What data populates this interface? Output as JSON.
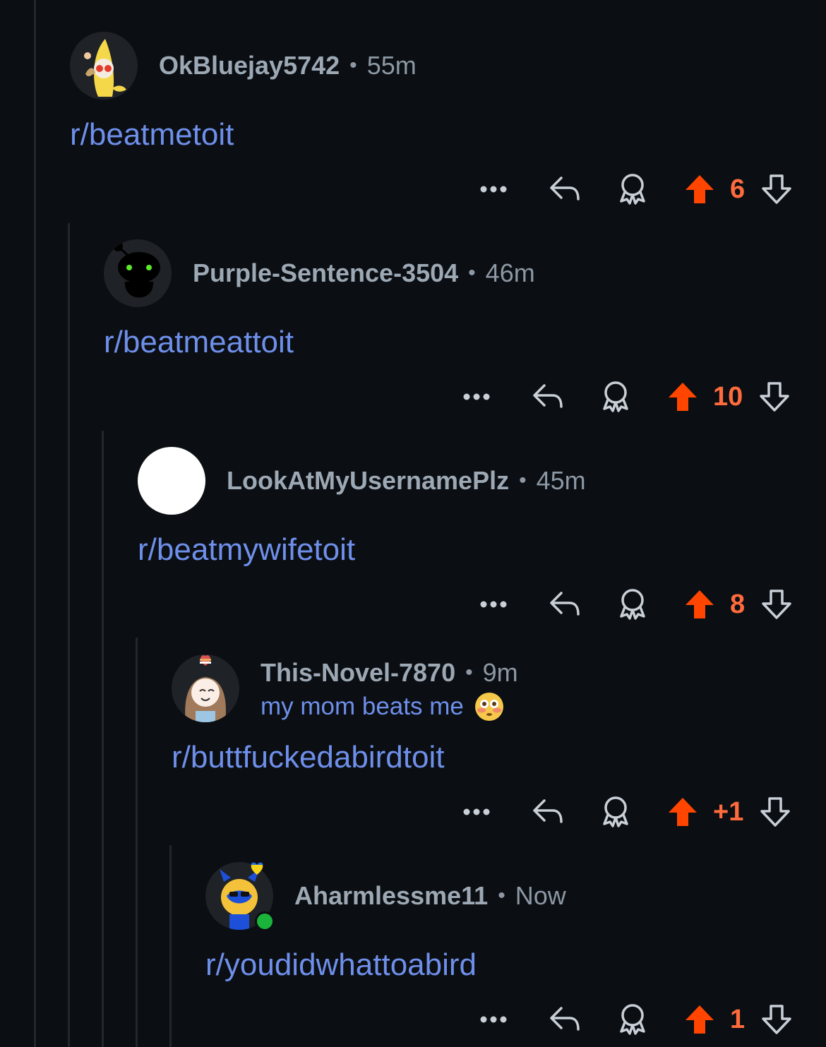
{
  "comments": [
    {
      "username": "OkBluejay5742",
      "time": "55m",
      "body": "r/beatmetoit",
      "score": "6",
      "avatar_icon": "banana-avatar-icon"
    },
    {
      "username": "Purple-Sentence-3504",
      "time": "46m",
      "body": "r/beatmeattoit",
      "score": "10",
      "avatar_icon": "snoo-silhouette-avatar-icon"
    },
    {
      "username": "LookAtMyUsernamePlz",
      "time": "45m",
      "body": "r/beatmywifetoit",
      "score": "8",
      "avatar_icon": "blank-avatar-icon"
    },
    {
      "username": "This-Novel-7870",
      "time": "9m",
      "flair": "my mom beats me",
      "flair_emoji": "flushed-face-emoji",
      "body": "r/buttfuckedabirdtoit",
      "score": "+1",
      "avatar_icon": "girl-avatar-icon"
    },
    {
      "username": "Aharmlessme11",
      "time": "Now",
      "body": "r/youdidwhattoabird",
      "score": "1",
      "avatar_icon": "dog-avatar-icon",
      "online": true
    }
  ],
  "separator": "•",
  "colors": {
    "background": "#0b0e12",
    "link": "#6e8fea",
    "upvote": "#ff4500",
    "score": "#ff6b3d",
    "muted": "#8c98a4",
    "thread_line": "#22272d"
  }
}
